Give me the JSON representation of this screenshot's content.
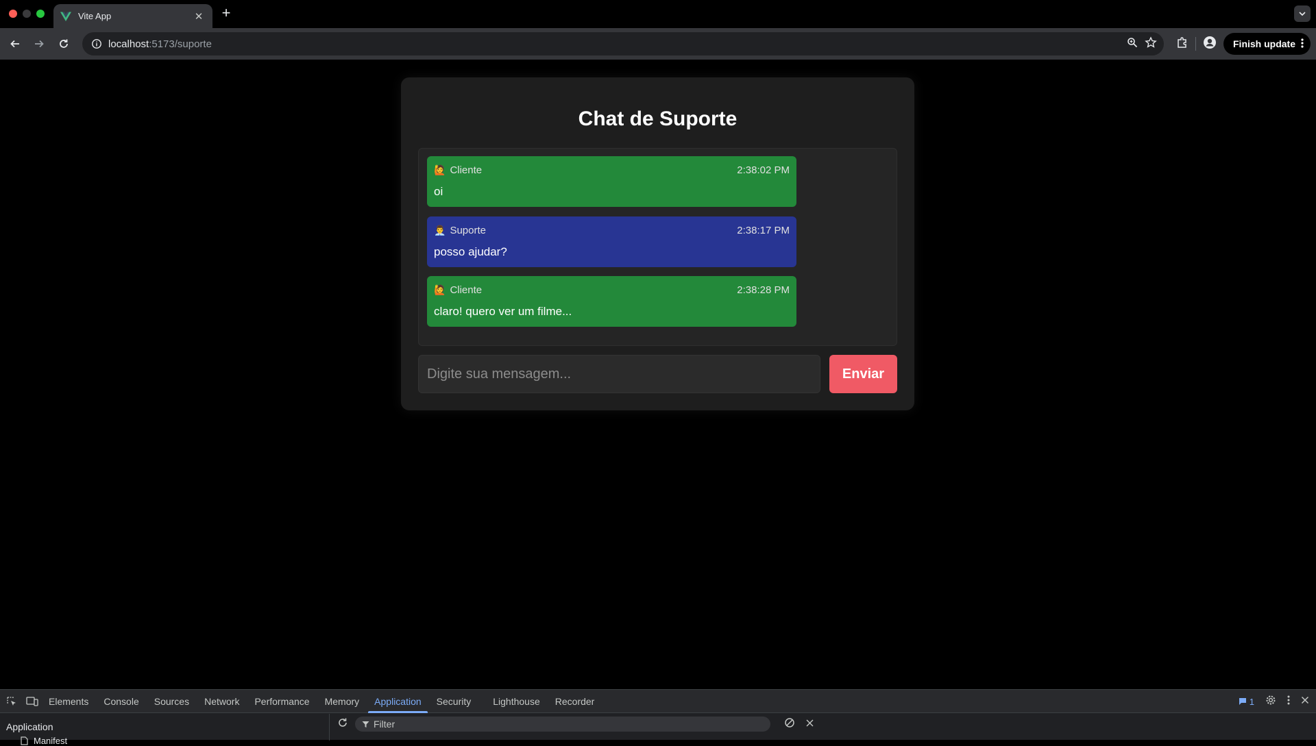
{
  "browser": {
    "tab_title": "Vite App",
    "url_host": "localhost",
    "url_path": ":5173/suporte",
    "finish_update_label": "Finish update"
  },
  "chat": {
    "title": "Chat de Suporte",
    "messages": [
      {
        "avatar": "🙋",
        "author": "Cliente",
        "time": "2:38:02 PM",
        "text": "oi",
        "role": "cliente"
      },
      {
        "avatar": "👨‍💼",
        "author": "Suporte",
        "time": "2:38:17 PM",
        "text": "posso ajudar?",
        "role": "suporte"
      },
      {
        "avatar": "🙋",
        "author": "Cliente",
        "time": "2:38:28 PM",
        "text": "claro! quero ver um filme...",
        "role": "cliente"
      }
    ],
    "input_placeholder": "Digite sua mensagem...",
    "send_label": "Enviar",
    "colors": {
      "cliente": "#23893a",
      "suporte": "#283593",
      "send": "#f05a65"
    }
  },
  "devtools": {
    "tabs": [
      "Elements",
      "Console",
      "Sources",
      "Network",
      "Performance",
      "Memory",
      "Application",
      "Security",
      "Lighthouse",
      "Recorder"
    ],
    "active_tab": "Application",
    "issues_count": "1",
    "sidebar_title": "Application",
    "sidebar_item": "Manifest",
    "filter_placeholder": "Filter"
  }
}
